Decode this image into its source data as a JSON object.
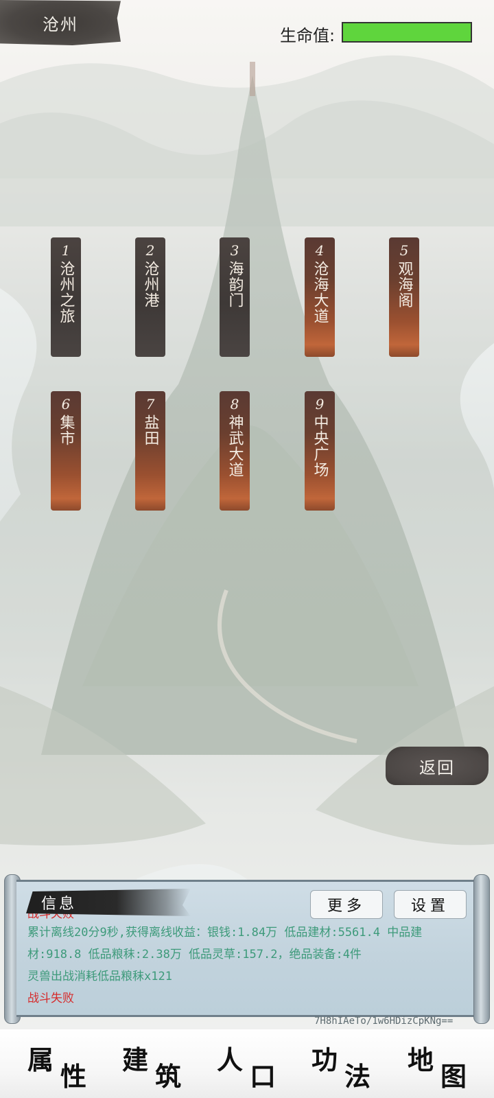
{
  "header": {
    "location": "沧州",
    "hp_label": "生命值:",
    "hp_fraction": 1.0,
    "hp_color": "#5fd53d"
  },
  "locations": [
    {
      "num": "1",
      "name": "沧州之旅",
      "style": "dark"
    },
    {
      "num": "2",
      "name": "沧州港",
      "style": "dark"
    },
    {
      "num": "3",
      "name": "海韵门",
      "style": "dark"
    },
    {
      "num": "4",
      "name": "沧海大道",
      "style": "orange"
    },
    {
      "num": "5",
      "name": "观海阁",
      "style": "orange"
    },
    {
      "num": "6",
      "name": "集市",
      "style": "orange"
    },
    {
      "num": "7",
      "name": "盐田",
      "style": "orange"
    },
    {
      "num": "8",
      "name": "神武大道",
      "style": "orange"
    },
    {
      "num": "9",
      "name": "中央广场",
      "style": "orange"
    }
  ],
  "back_label": "返回",
  "info": {
    "title": "信息",
    "more_label": "更多",
    "settings_label": "设置",
    "partial_top": "战斗失败",
    "log": [
      {
        "text": "累计离线20分9秒,获得离线收益：银钱:1.84万 低品建材:5561.4 中品建材:918.8 低品粮秣:2.38万 低品灵草:157.2，绝品装备:4件",
        "color": "green"
      },
      {
        "text": "灵兽出战消耗低品粮秣x121",
        "color": "green"
      },
      {
        "text": "战斗失败",
        "color": "red"
      }
    ]
  },
  "session_id": "7H8hIAeTo/1w6HDizCpKNg==",
  "nav": {
    "attributes": [
      "属",
      "性"
    ],
    "build": [
      "建",
      "筑"
    ],
    "population": [
      "人",
      "口"
    ],
    "skills": [
      "功",
      "法"
    ],
    "map": [
      "地",
      "图"
    ]
  }
}
